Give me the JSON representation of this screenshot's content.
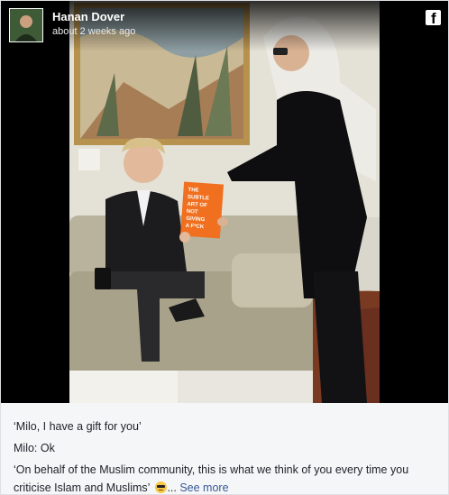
{
  "post": {
    "author": "Hanan Dover",
    "timestamp": "about 2 weeks ago",
    "platform_icon": "facebook-icon",
    "book_text": [
      "THE",
      "SUBTLE",
      "ART OF",
      "NOT",
      "GIVING",
      "A F*CK"
    ]
  },
  "caption": {
    "line1": "‘Milo, I have a gift for you’",
    "line2": "Milo: Ok",
    "line3": "‘On behalf of the Muslim community, this is what we think of you every time you",
    "line4": "criticise Islam and Muslims’",
    "ellipsis": "...",
    "see_more": "See more",
    "emoji": "sunglasses-emoji"
  },
  "colors": {
    "link": "#365899",
    "text": "#1d2129",
    "book": "#f0701f"
  }
}
